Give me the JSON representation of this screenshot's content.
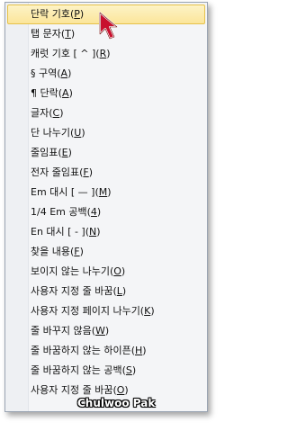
{
  "menu": {
    "items": [
      {
        "label": "단락 기호(P)",
        "highlighted": true
      },
      {
        "label": "탭 문자(T)"
      },
      {
        "label": "캐럿 기호 [ ^ ](R)"
      },
      {
        "label": "§ 구역(A)"
      },
      {
        "label": "¶ 단락(A)"
      },
      {
        "label": "글자(C)"
      },
      {
        "label": "단 나누기(U)"
      },
      {
        "label": "줄임표(E)"
      },
      {
        "label": "전자 줄임표(F)"
      },
      {
        "label": "Em 대시 [ — ](M)"
      },
      {
        "label": "1/4 Em 공백(4)"
      },
      {
        "label": "En 대시 [ - ](N)"
      },
      {
        "label": "찾을 내용(F)"
      },
      {
        "label": "보이지 않는 나누기(O)"
      },
      {
        "label": "사용자 지정 줄 바꿈(L)"
      },
      {
        "label": "사용자 지정 페이지 나누기(K)"
      },
      {
        "label": "줄 바꾸지 않음(W)"
      },
      {
        "label": "줄 바꿈하지 않는 하이픈(H)"
      },
      {
        "label": "줄 바꿈하지 않는 공백(S)"
      },
      {
        "label": "사용자 지정 줄 바꿈(O)"
      }
    ]
  },
  "cursor_icon": "mouse-pointer-icon",
  "watermark": "Chulwoo Pak",
  "colors": {
    "highlight": "#fbe59a",
    "highlight_border": "#e6c24a",
    "cursor": "#c8102e"
  }
}
